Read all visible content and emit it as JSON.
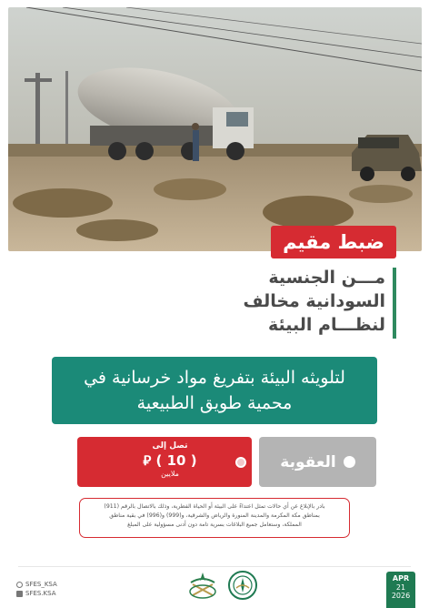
{
  "tag": {
    "label": "ضبط مقيم"
  },
  "title": {
    "line1": "مـــن الجنسية",
    "line2": "السودانية مخالف",
    "line3": "لنظـــام البيئة"
  },
  "offense": {
    "line1": "لتلويثه البيئة بتفريغ مواد خرسانية في",
    "line2": "محمية طويق الطبيعية"
  },
  "penalty": {
    "label": "العقوبة",
    "prefix": "تصل إلى",
    "amount": "( 10 ) ⃁",
    "unit": "ملايين"
  },
  "notice": {
    "line1": "بادر بالإبلاغ عن أي حالات تمثل اعتداءً على البيئة أو الحياة الفطرية، وذلك بالاتصال بالرقم (911)",
    "line2": "بمناطق مكة المكرمة والمدينة المنورة والرياض والشرقية، و(999) و(996) في بقية مناطق",
    "line3": "المملكة، وستعامل جميع البلاغات بسرية تامة دون أدنى مسؤولية على المبلغ"
  },
  "footer": {
    "handle_x": "SFES_KSA",
    "handle_yt": "SFES.KSA",
    "date_month": "APR",
    "date_day": "21",
    "date_year": "2026"
  },
  "colors": {
    "red": "#d62b32",
    "teal": "#1b8a78",
    "green": "#1f7a52",
    "gray": "#b4b4b4"
  }
}
